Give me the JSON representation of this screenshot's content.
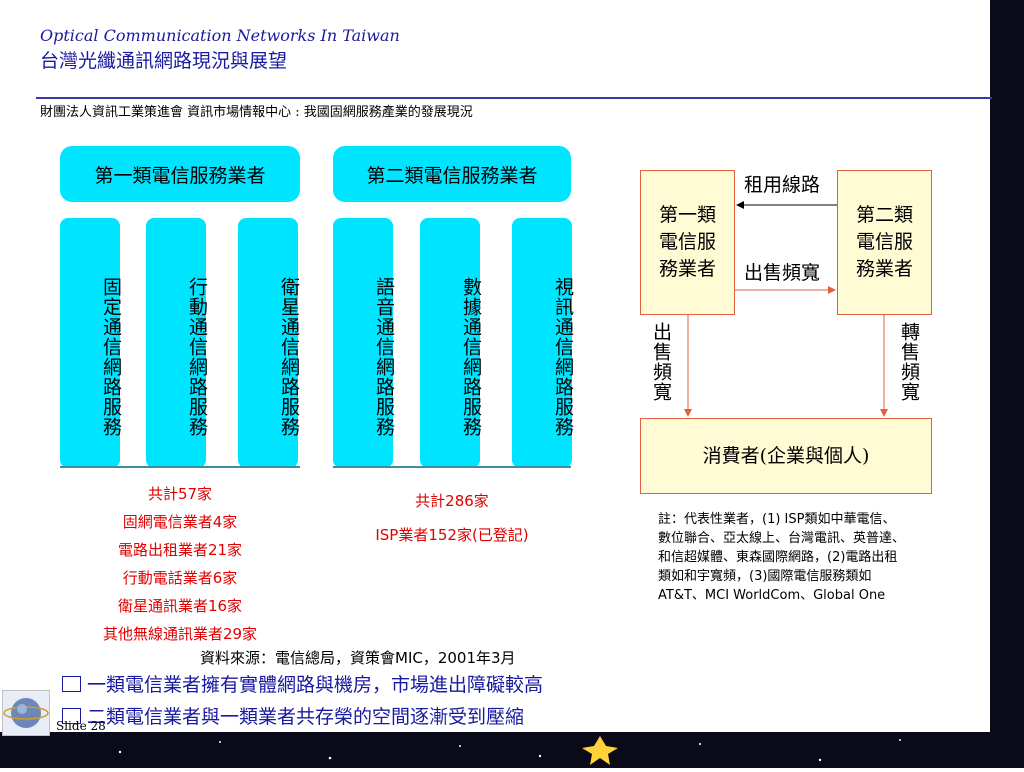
{
  "header": {
    "title_en": "Optical Communication Networks In Taiwan",
    "title_zh": "台灣光纖通訊網路現況與展望",
    "subtitle": "財團法人資訊工業策進會 資訊市場情報中心 : 我國固網服務產業的發展現況"
  },
  "categories": {
    "type1": "第一類電信服務業者",
    "type2": "第二類電信服務業者"
  },
  "services": [
    "固定通信網路服務",
    "行動通信網路服務",
    "衛星通信網路服務",
    "語音通信網路服務",
    "數據通信網路服務",
    "視訊通信網路服務"
  ],
  "type1_stats": [
    "共計57家",
    "固網電信業者4家",
    "電路出租業者21家",
    "行動電話業者6家",
    "衛星通訊業者16家",
    "其他無線通訊業者29家"
  ],
  "type2_stats": [
    "共計286家",
    "ISP業者152家(已登記)"
  ],
  "flow": {
    "box_type1": "第一類電信服務業者",
    "box_type2": "第二類電信服務業者",
    "box_consumer": "消費者(企業與個人)",
    "lease_label": "租用線路",
    "sell_label": "出售頻寬",
    "left_down_label": "出售頻寬",
    "right_down_label": "轉售頻寬"
  },
  "note": "註：代表性業者，(1) ISP類如中華電信、數位聯合、亞太線上、台灣電訊、英普達、和信超媒體、東森國際網路，(2)電路出租類如和宇寬頻，(3)國際電信服務類如AT&T、MCI WorldCom、Global One",
  "source": "資料來源：電信總局，資策會MIC，2001年3月",
  "bullets": [
    "一類電信業者擁有實體網路與機房，市場進出障礙較高",
    "二類電信業者與一類業者共存榮的空間逐漸受到壓縮"
  ],
  "footer": {
    "slide": "Slide 28"
  },
  "colors": {
    "accent": "#00e5ff",
    "title": "#1a1aa0",
    "stats": "#e00000",
    "box_fill": "#fffbd4",
    "box_border": "#e06040"
  }
}
